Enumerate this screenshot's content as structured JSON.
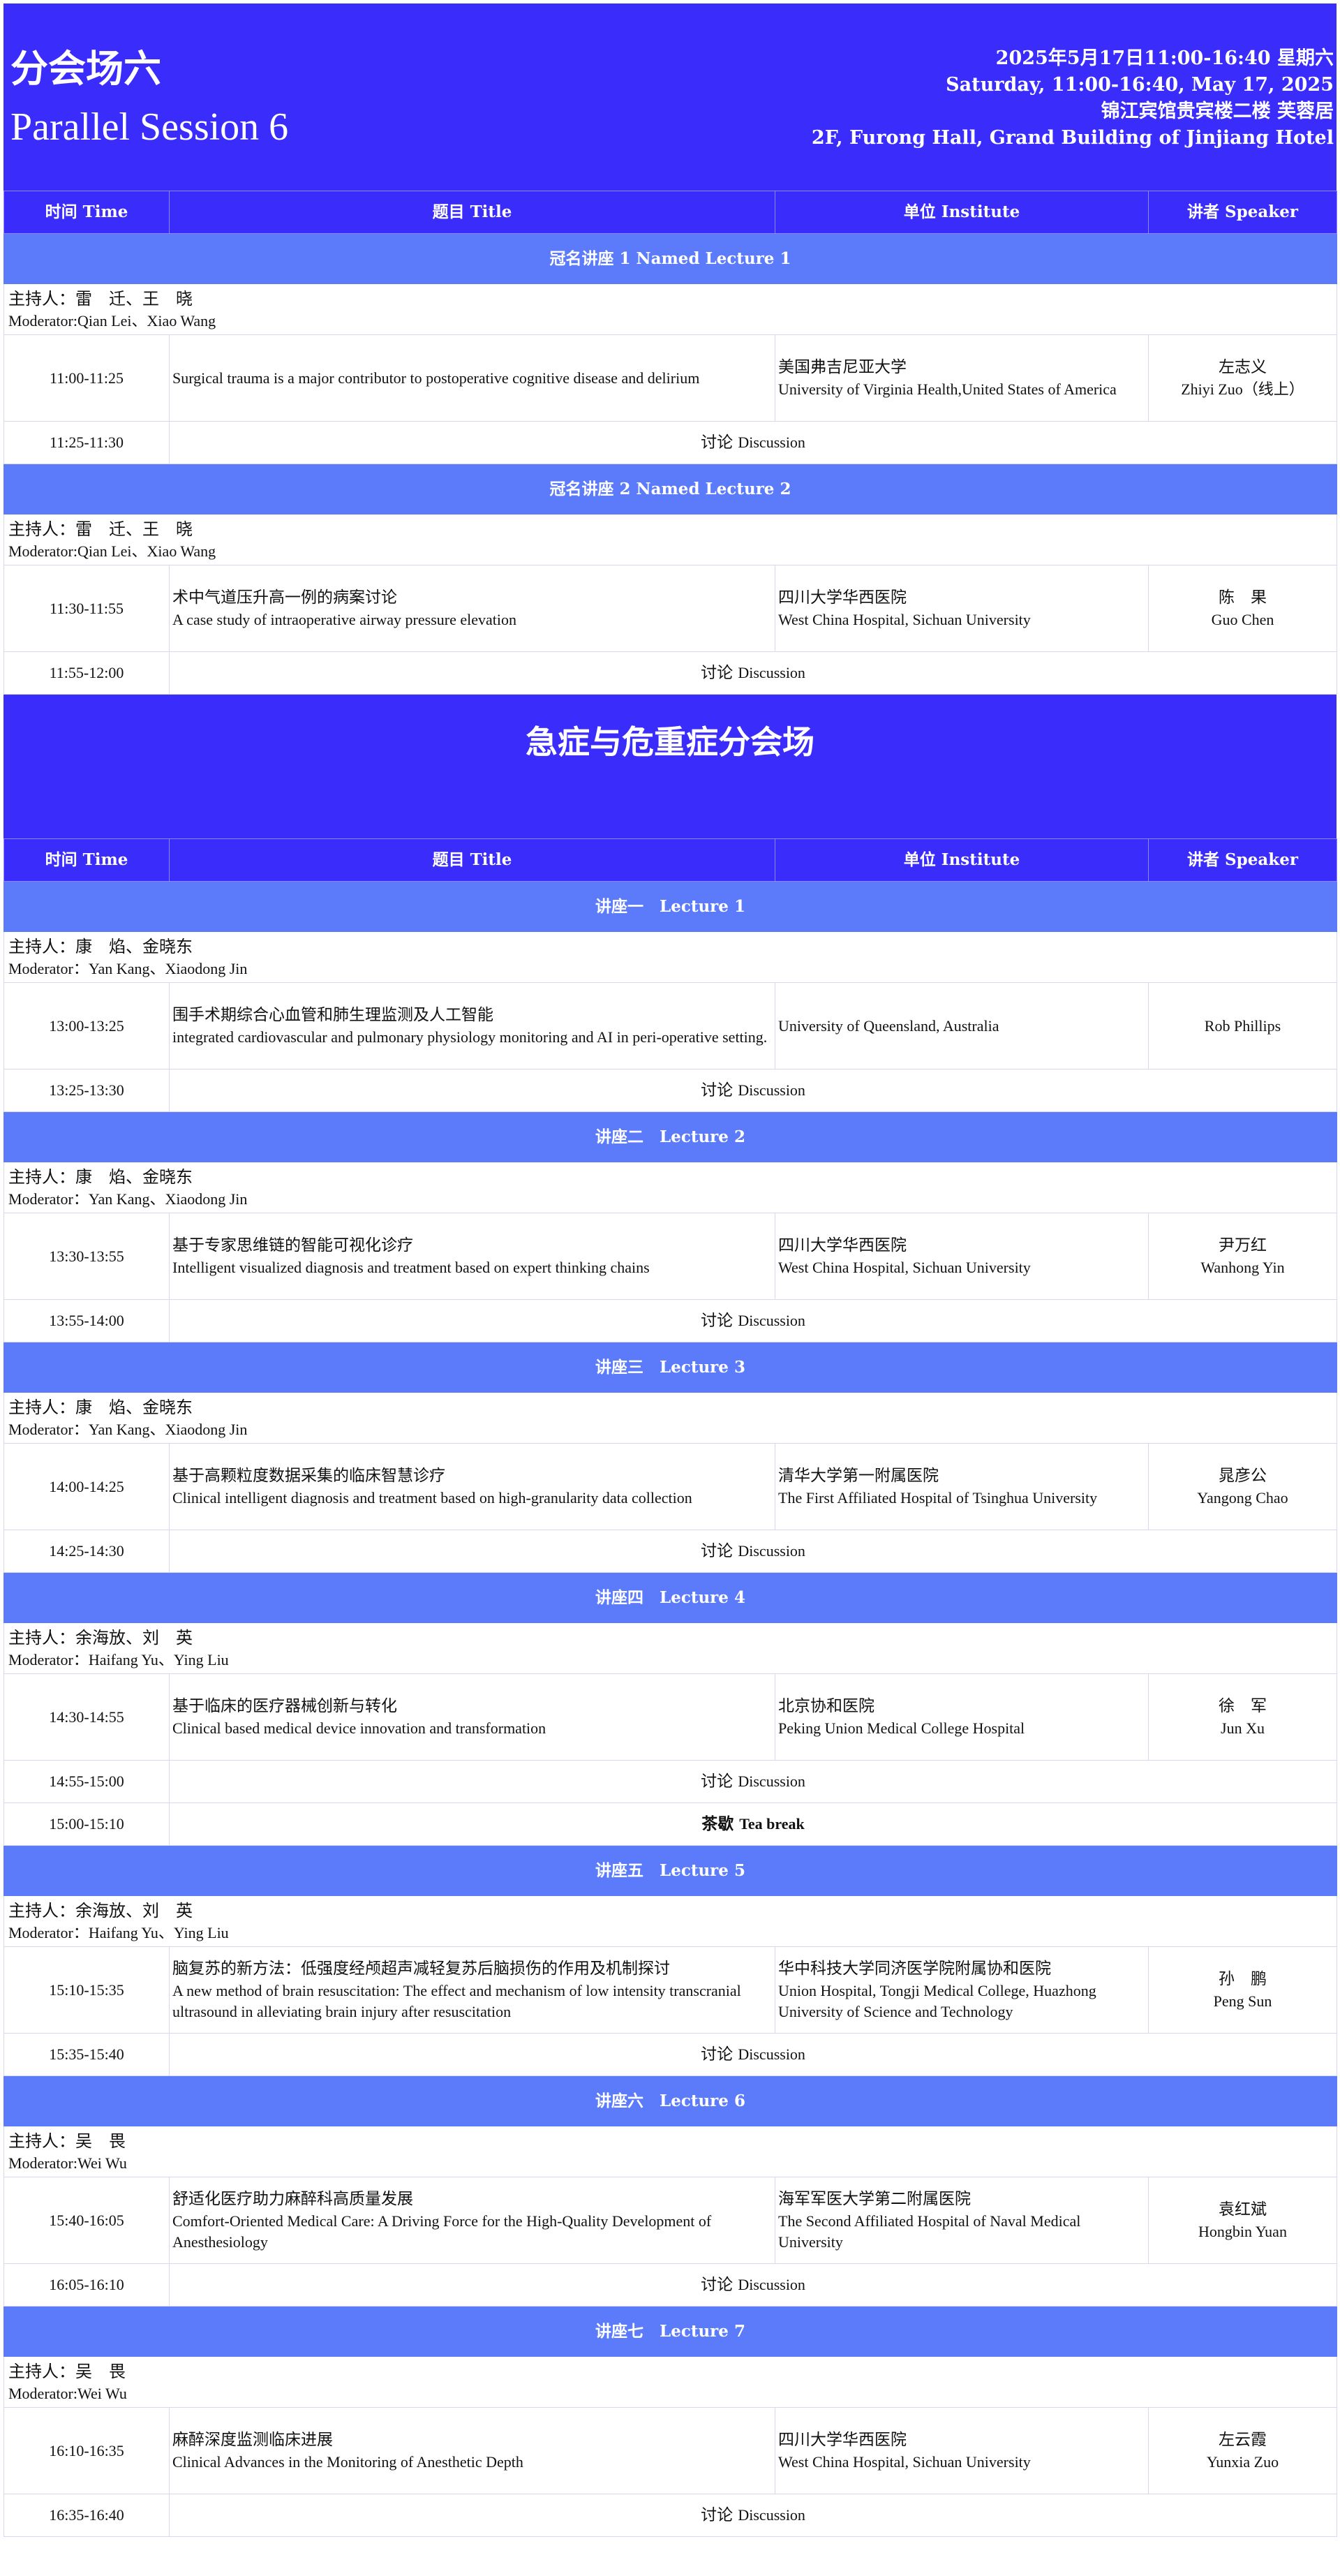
{
  "header": {
    "title_zh": "分会场六",
    "title_en": "Parallel Session 6",
    "date_zh": "2025年5月17日11:00-16:40  星期六",
    "date_en": "Saturday, 11:00-16:40, May 17, 2025",
    "venue_zh": "锦江宾馆贵宾楼二楼 芙蓉居",
    "venue_en": "2F, Furong Hall, Grand Building of Jinjiang Hotel"
  },
  "columns": {
    "time": "时间 Time",
    "title": "题目 Title",
    "institute": "单位 Institute",
    "speaker": "讲者 Speaker"
  },
  "part2_title": "急症与危重症分会场",
  "discussion": "讨论",
  "discussion_en": "Discussion",
  "sessions_part1": [
    {
      "label": "冠名讲座 1  Named Lecture 1",
      "mod_zh": "主持人：雷　迁、王　晓",
      "mod_en": "Moderator:Qian Lei、Xiao Wang",
      "time": "11:00-11:25",
      "title_zh": "",
      "title_en": "Surgical trauma is a major contributor to postoperative cognitive disease and delirium",
      "inst_zh": "美国弗吉尼亚大学",
      "inst_en": "University of Virginia Health,United States of America",
      "spk_zh": "左志义",
      "spk_en": "Zhiyi Zuo（线上）",
      "disc_time": "11:25-11:30"
    },
    {
      "label": "冠名讲座 2  Named Lecture 2",
      "mod_zh": "主持人：雷　迁、王　晓",
      "mod_en": "Moderator:Qian Lei、Xiao Wang",
      "time": "11:30-11:55",
      "title_zh": "术中气道压升高一例的病案讨论",
      "title_en": "A case study of intraoperative airway pressure elevation",
      "inst_zh": "四川大学华西医院",
      "inst_en": "West China Hospital, Sichuan University",
      "spk_zh": "陈　果",
      "spk_en": "Guo Chen",
      "disc_time": "11:55-12:00"
    }
  ],
  "sessions_part2": [
    {
      "label": "讲座一　Lecture 1",
      "mod_zh": "主持人：康　焰、金晓东",
      "mod_en": "Moderator：Yan Kang、Xiaodong Jin",
      "time": "13:00-13:25",
      "title_zh": "围手术期综合心血管和肺生理监测及人工智能",
      "title_en": "integrated cardiovascular and pulmonary physiology monitoring and AI in peri-operative setting.",
      "inst_zh": "",
      "inst_en": "University of Queensland, Australia",
      "spk_zh": "",
      "spk_en": "Rob Phillips",
      "disc_time": "13:25-13:30"
    },
    {
      "label": "讲座二　Lecture 2",
      "mod_zh": "主持人：康　焰、金晓东",
      "mod_en": "Moderator：Yan Kang、Xiaodong Jin",
      "time": "13:30-13:55",
      "title_zh": "基于专家思维链的智能可视化诊疗",
      "title_en": "Intelligent visualized diagnosis and treatment based on expert thinking chains",
      "inst_zh": "四川大学华西医院",
      "inst_en": "West China Hospital, Sichuan University",
      "spk_zh": "尹万红",
      "spk_en": "Wanhong Yin",
      "disc_time": "13:55-14:00"
    },
    {
      "label": "讲座三　Lecture 3",
      "mod_zh": "主持人：康　焰、金晓东",
      "mod_en": "Moderator：Yan Kang、Xiaodong Jin",
      "time": "14:00-14:25",
      "title_zh": "基于高颗粒度数据采集的临床智慧诊疗",
      "title_en": "Clinical intelligent diagnosis and treatment based on high-granularity data collection",
      "inst_zh": "清华大学第一附属医院",
      "inst_en": "The First Affiliated Hospital of Tsinghua University",
      "spk_zh": "晁彦公",
      "spk_en": "Yangong Chao",
      "disc_time": "14:25-14:30"
    },
    {
      "label": "讲座四　Lecture 4",
      "mod_zh": "主持人：余海放、刘　英",
      "mod_en": "Moderator：Haifang Yu、Ying Liu",
      "time": "14:30-14:55",
      "title_zh": "基于临床的医疗器械创新与转化",
      "title_en": "Clinical based medical device innovation and transformation",
      "inst_zh": "北京协和医院",
      "inst_en": "Peking Union Medical College Hospital",
      "spk_zh": "徐　军",
      "spk_en": "Jun  Xu",
      "disc_time": "14:55-15:00",
      "break_time": "15:00-15:10",
      "break_zh": "茶歇",
      "break_en": "Tea break"
    },
    {
      "label": "讲座五　Lecture 5",
      "mod_zh": "主持人：余海放、刘　英",
      "mod_en": "Moderator：Haifang Yu、Ying Liu",
      "time": "15:10-15:35",
      "title_zh": "脑复苏的新方法：低强度经颅超声减轻复苏后脑损伤的作用及机制探讨",
      "title_en": "A new method of brain resuscitation: The effect and mechanism of low intensity transcranial ultrasound in alleviating brain injury after resuscitation",
      "inst_zh": "华中科技大学同济医学院附属协和医院",
      "inst_en": "Union Hospital, Tongji Medical College, Huazhong University of Science and Technology",
      "spk_zh": "孙　鹏",
      "spk_en": "Peng Sun",
      "disc_time": "15:35-15:40"
    },
    {
      "label": "讲座六　Lecture 6",
      "mod_zh": "主持人：吴　畏",
      "mod_en": "Moderator:Wei Wu",
      "time": "15:40-16:05",
      "title_zh": "舒适化医疗助力麻醉科高质量发展",
      "title_en": "Comfort-Oriented Medical Care: A Driving Force for the High-Quality Development of Anesthesiology",
      "inst_zh": "海军军医大学第二附属医院",
      "inst_en": "The Second Affiliated Hospital of Naval Medical University",
      "spk_zh": "袁红斌",
      "spk_en": "Hongbin Yuan",
      "disc_time": "16:05-16:10"
    },
    {
      "label": "讲座七　Lecture 7",
      "mod_zh": "主持人：吴　畏",
      "mod_en": "Moderator:Wei Wu",
      "time": "16:10-16:35",
      "title_zh": "麻醉深度监测临床进展",
      "title_en": "Clinical Advances in the Monitoring of Anesthetic Depth",
      "inst_zh": "四川大学华西医院",
      "inst_en": "West China Hospital, Sichuan University",
      "spk_zh": "左云霞",
      "spk_en": "Yunxia Zuo",
      "disc_time": "16:35-16:40"
    }
  ]
}
